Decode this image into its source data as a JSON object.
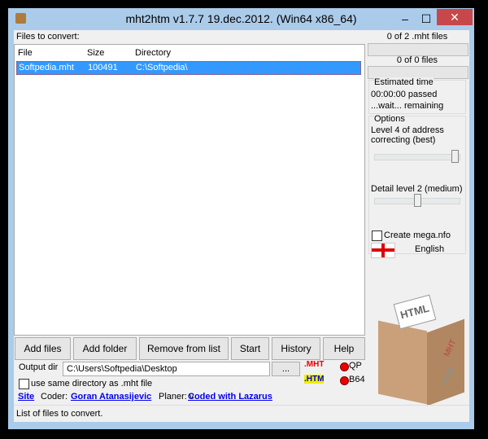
{
  "window": {
    "title": "mht2htm v1.7.7 19.dec.2012.  (Win64 x86_64)",
    "minimize": "–",
    "maximize": "☐",
    "close": "✕"
  },
  "files_label": "Files to convert:",
  "list": {
    "columns": [
      "File",
      "Size",
      "Directory"
    ],
    "rows": [
      {
        "file": "Softpedia.mht",
        "size": "100491",
        "directory": "C:\\Softpedia\\"
      }
    ]
  },
  "progress": {
    "mht_files": "0 of 2 .mht files",
    "files": "0 of 0 files",
    "mht_fraction": 0,
    "files_fraction": 0
  },
  "estimated": {
    "title": "Estimated time",
    "passed": "00:00:00 passed",
    "remaining": "...wait... remaining"
  },
  "options": {
    "title": "Options",
    "address_label": "Level 4 of address correcting (best)",
    "address_level": 4,
    "address_max": 4,
    "detail_label": "Detail level 2 (medium)",
    "detail_level": 2,
    "detail_max": 4,
    "mega_label": "Create mega.nfo",
    "mega_checked": false,
    "language": "English"
  },
  "buttons": {
    "add_files": "Add files",
    "add_folder": "Add folder",
    "remove": "Remove from list",
    "start": "Start",
    "history": "History",
    "help": "Help",
    "browse": "..."
  },
  "output": {
    "label": "Output dir",
    "value": "C:\\Users\\Softpedia\\Desktop",
    "same_dir_label": "use same directory as .mht file",
    "same_dir_checked": false
  },
  "logo": {
    "top": ".MHT",
    "bottom": ".HTM",
    "qp": "QP",
    "b64": "B64",
    "box_top": "HTML",
    "box_side1": "MHT",
    "box_side2": "HTM"
  },
  "credits": {
    "site": "Site",
    "coder_label": "Coder:",
    "coder": "Goran Atanasijevic",
    "planer_label": "Planer: v",
    "lazarus": "Coded with Lazarus"
  },
  "status": "List of files to convert."
}
